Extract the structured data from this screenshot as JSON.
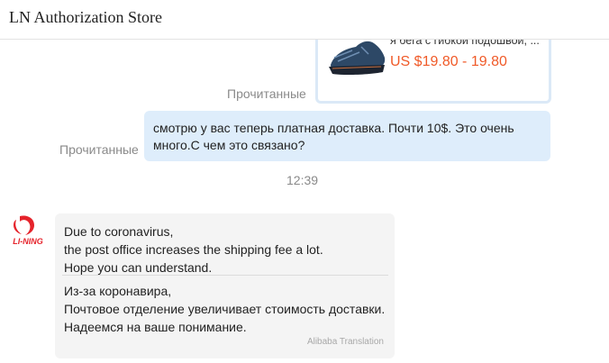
{
  "header": {
    "title": "LN Authorization Store"
  },
  "product": {
    "title": "я бега с гибкой подошвой, ...",
    "price": "US $19.80 - 19.80",
    "colors": {
      "price": "#f05a28",
      "card_border": "#dbe9f7"
    }
  },
  "status": {
    "read_label": "Прочитанные"
  },
  "outgoing": {
    "line1": "смотрю у вас теперь платная доставка. Почти 10$. Это очень",
    "line2": "много.С чем это связано?",
    "bubble_color": "#deedfb"
  },
  "timestamp": "12:39",
  "incoming": {
    "avatar_logo": "LI-NING",
    "en_lines": [
      "Due to coronavirus,",
      "the post office increases the shipping fee a lot.",
      "Hope you can understand."
    ],
    "ru_lines": [
      "Из-за коронавира,",
      "Почтовое отделение увеличивает стоимость доставки.",
      "Надеемся на ваше понимание."
    ],
    "translation_label": "Alibaba Translation",
    "bubble_color": "#f4f4f4"
  }
}
